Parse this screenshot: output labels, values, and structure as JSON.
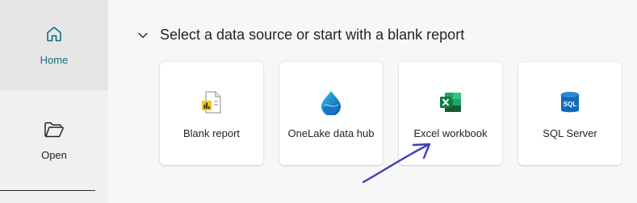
{
  "nav": {
    "home_label": "Home",
    "open_label": "Open"
  },
  "section": {
    "title": "Select a data source or start with a blank report"
  },
  "cards": [
    {
      "label": "Blank report",
      "icon": "blank-report-icon"
    },
    {
      "label": "OneLake data hub",
      "icon": "onelake-icon"
    },
    {
      "label": "Excel workbook",
      "icon": "excel-icon"
    },
    {
      "label": "SQL Server",
      "icon": "sql-server-icon"
    }
  ],
  "colors": {
    "accent": "#106e7a",
    "annotation_arrow": "#3d3fb8",
    "excel_green": "#107c41",
    "sql_blue": "#0f6cbd"
  }
}
